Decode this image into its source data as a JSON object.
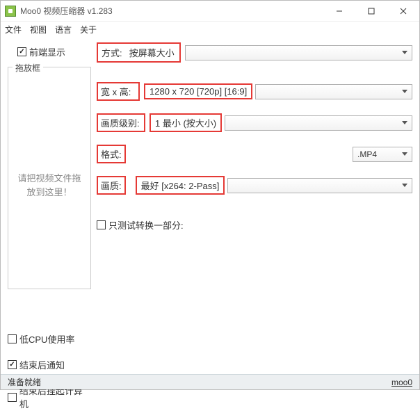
{
  "window": {
    "title": "Moo0 视频压缩器 v1.283"
  },
  "menu": {
    "file": "文件",
    "view": "视图",
    "language": "语言",
    "about": "关于"
  },
  "left": {
    "always_on_top": "前端显示",
    "dropbox_title": "拖放框",
    "dropbox_hint_line1": "请把视频文件拖",
    "dropbox_hint_line2": "放到这里！",
    "low_cpu": "低CPU使用率",
    "notify_done": "结束后通知",
    "suspend_after": "结束后挂起计算机"
  },
  "fields": {
    "method_label": "方式:",
    "method_value": "按屏幕大小",
    "wh_label": "宽 x 高:",
    "wh_value": "1280 x 720    [720p]    [16:9]",
    "quality_level_label": "画质级别:",
    "quality_level_value": "1   最小  (按大小)",
    "format_label": "格式:",
    "format_value": ".MP4",
    "quality_label": "画质:",
    "quality_value": "最好      [x264: 2-Pass]",
    "test_portion": "只测试转换一部分:"
  },
  "status": {
    "ready": "准备就绪",
    "link": "moo0"
  },
  "checked": {
    "always_on_top": true,
    "low_cpu": false,
    "notify_done": true,
    "suspend_after": false,
    "test_portion": false
  }
}
